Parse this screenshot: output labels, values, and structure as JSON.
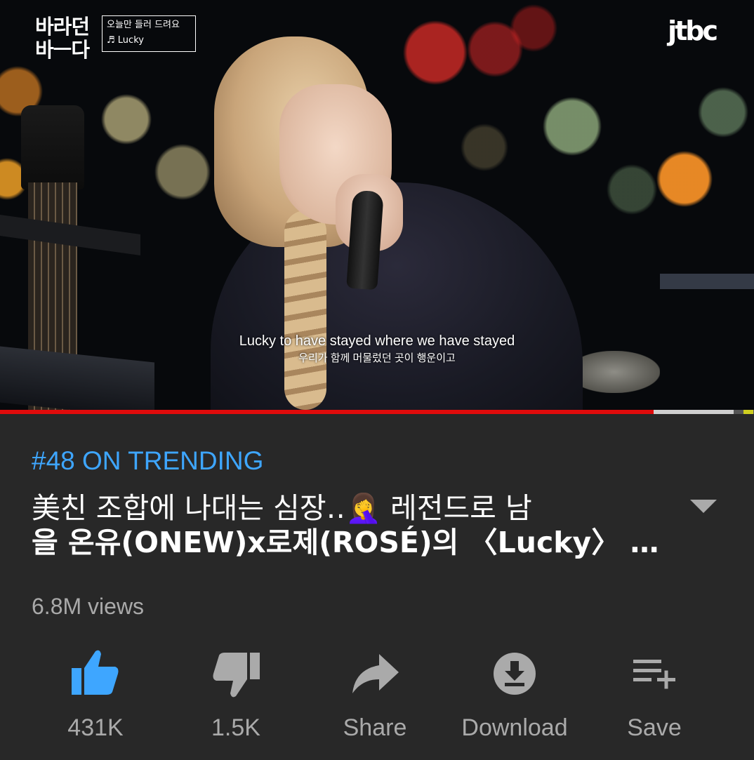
{
  "video": {
    "show_logo_line1": "바라던",
    "show_logo_line2": "바ㅡ다",
    "show_sub_line1": "오늘만 들러 드려요",
    "show_sub_line2": "♬ Lucky",
    "network_logo": "jtbc",
    "subtitle_en": "Lucky to have stayed where we have stayed",
    "subtitle_ko": "우리가 함께 머물렀던 곳이 행운이고",
    "progress_played": 0.867,
    "progress_buffered": 0.973
  },
  "trending_label": "#48 ON TRENDING",
  "title_line1": "美친 조합에 나대는 심장‥🤦‍♀️ 레전드로 남",
  "title_line2": "을 온유(ONEW)x로제(ROSÉ)의 〈Lucky〉 …",
  "views": "6.8M views",
  "actions": {
    "like": "431K",
    "dislike": "1.5K",
    "share": "Share",
    "download": "Download",
    "save": "Save"
  },
  "colors": {
    "accent_like": "#3ea6ff",
    "trending": "#3ea6ff",
    "progress": "#e00b0b",
    "background": "#282828",
    "icon": "#aaaaaa"
  }
}
